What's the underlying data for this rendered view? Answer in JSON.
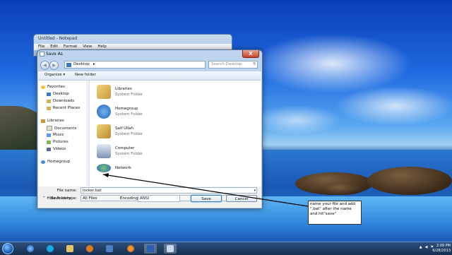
{
  "notepad": {
    "title": "Untitled - Notepad",
    "menu": [
      "File",
      "Edit",
      "Format",
      "View",
      "Help"
    ]
  },
  "dialog": {
    "title": "Save As",
    "address": "Desktop",
    "address_arrow": "▸",
    "search_placeholder": "Search Desktop",
    "toolbar": {
      "organize": "Organize ▾",
      "new_folder": "New folder"
    },
    "nav": {
      "favorites": "Favorites",
      "desktop": "Desktop",
      "downloads": "Downloads",
      "recent": "Recent Places",
      "libraries": "Libraries",
      "documents": "Documents",
      "music": "Music",
      "pictures": "Pictures",
      "videos": "Videos",
      "homegroup": "Homegroup"
    },
    "files": [
      {
        "name": "Libraries",
        "type": "System Folder"
      },
      {
        "name": "Homegroup",
        "type": "System Folder"
      },
      {
        "name": "Saif Ullah",
        "type": "System Folder"
      },
      {
        "name": "Computer",
        "type": "System Folder"
      },
      {
        "name": "Network",
        "type": ""
      }
    ],
    "file_name_label": "File name:",
    "file_name_value": "locker.bat",
    "save_type_label": "Save as type:",
    "save_type_value": "All Files",
    "hide_folders": "Hide Folders",
    "encoding_label": "Encoding:",
    "encoding_value": "ANSI",
    "save": "Save",
    "cancel": "Cancel",
    "close_glyph": "X"
  },
  "annotation": {
    "text": "name your file and add \".bat\" after the name and hit\"save\""
  },
  "taskbar": {
    "time": "2:09 PM",
    "date": "6/28/2013"
  },
  "colors": {
    "accent": "#1f6ae0",
    "close": "#c8452b"
  }
}
